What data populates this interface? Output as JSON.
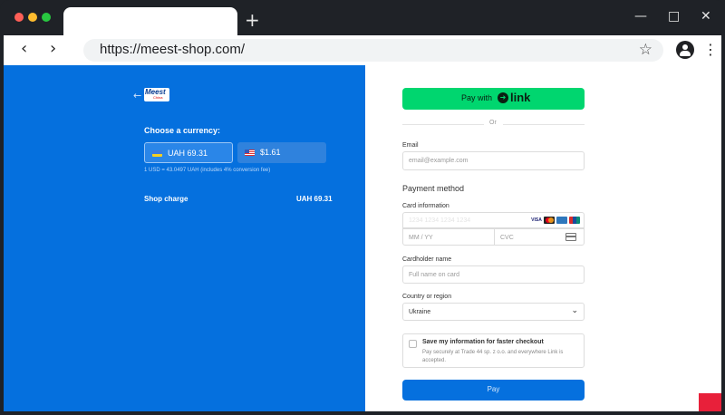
{
  "browser": {
    "url": "https://meest-shop.com/",
    "new_tab_label": "+"
  },
  "merchant": {
    "logo_text": "Meest",
    "logo_sub": "China"
  },
  "currency": {
    "heading": "Choose a currency:",
    "options": [
      {
        "label": "UAH 69.31",
        "selected": true
      },
      {
        "label": "$1.61",
        "selected": false
      }
    ],
    "rate_note": "1 USD = 43.0497 UAH (includes 4% conversion fee)"
  },
  "summary": {
    "label": "Shop charge",
    "amount": "UAH 69.31"
  },
  "checkout": {
    "link_prefix": "Pay with",
    "link_word": "link",
    "or_text": "Or",
    "email_label": "Email",
    "email_placeholder": "email@example.com",
    "payment_heading": "Payment method",
    "card_label": "Card information",
    "card_placeholder": "1234 1234 1234 1234",
    "expiry_placeholder": "MM / YY",
    "cvc_placeholder": "CVC",
    "card_brands": [
      "VISA",
      "Mastercard",
      "Amex",
      "UnionPay"
    ],
    "cardholder_label": "Cardholder name",
    "cardholder_placeholder": "Full name on card",
    "country_label": "Country or region",
    "country_value": "Ukraine",
    "save_title": "Save my information for faster checkout",
    "save_desc": "Pay securely at Trade 44 sp. z o.o. and everywhere Link is accepted.",
    "pay_label": "Pay"
  },
  "colors": {
    "left_pane": "#0570de",
    "link_button": "#00d66f",
    "pay_button": "#0570de"
  }
}
